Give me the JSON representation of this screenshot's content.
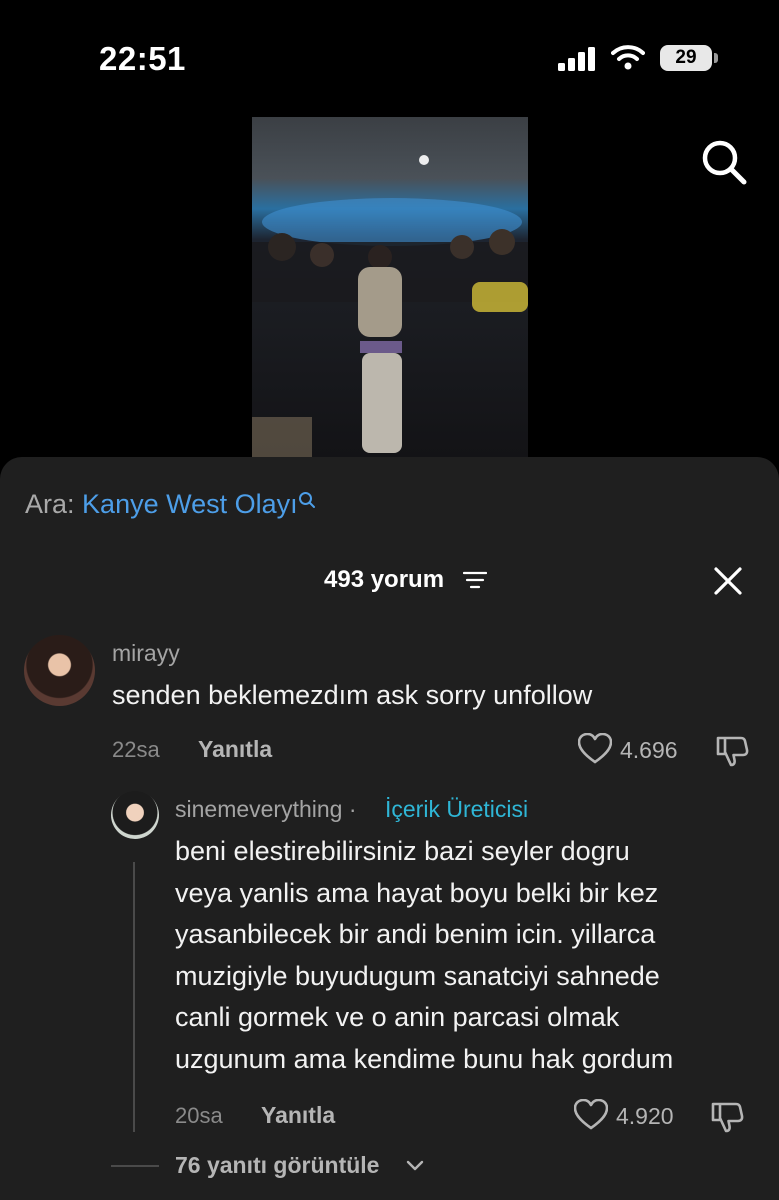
{
  "status_bar": {
    "time": "22:51",
    "battery": "29"
  },
  "search_suggestion": {
    "prefix": "Ara:",
    "query": "Kanye West Olayı"
  },
  "comments_header": {
    "count_label": "493 yorum"
  },
  "comments": [
    {
      "username": "mirayy",
      "text": "senden beklemezdım ask sorry unfollow",
      "timestamp": "22sa",
      "reply_label": "Yanıtla",
      "likes": "4.696"
    }
  ],
  "reply": {
    "username": "sinemeverything",
    "separator": "·",
    "badge": "İçerik Üreticisi",
    "lines": [
      "beni elestirebilirsiniz bazi seyler dogru",
      "veya yanlis ama hayat boyu belki bir kez",
      "yasanbilecek bir andi benim icin. yillarca",
      "muzigiyle buyudugum sanatciyi sahnede",
      "canli gormek ve o anin parcasi olmak",
      "uzgunum ama kendime bunu hak gordum"
    ],
    "timestamp": "20sa",
    "reply_label": "Yanıtla",
    "likes": "4.920"
  },
  "view_replies": {
    "label": "76 yanıtı görüntüle"
  },
  "icons": [
    "cellular-signal-icon",
    "wifi-icon",
    "battery-icon",
    "search-icon",
    "sort-icon",
    "close-icon",
    "heart-icon",
    "dislike-icon",
    "chevron-down-icon"
  ],
  "colors": {
    "link": "#4d9ee8",
    "creator_badge": "#2fb6d6",
    "panel": "#1f1f1f",
    "background": "#000000"
  }
}
